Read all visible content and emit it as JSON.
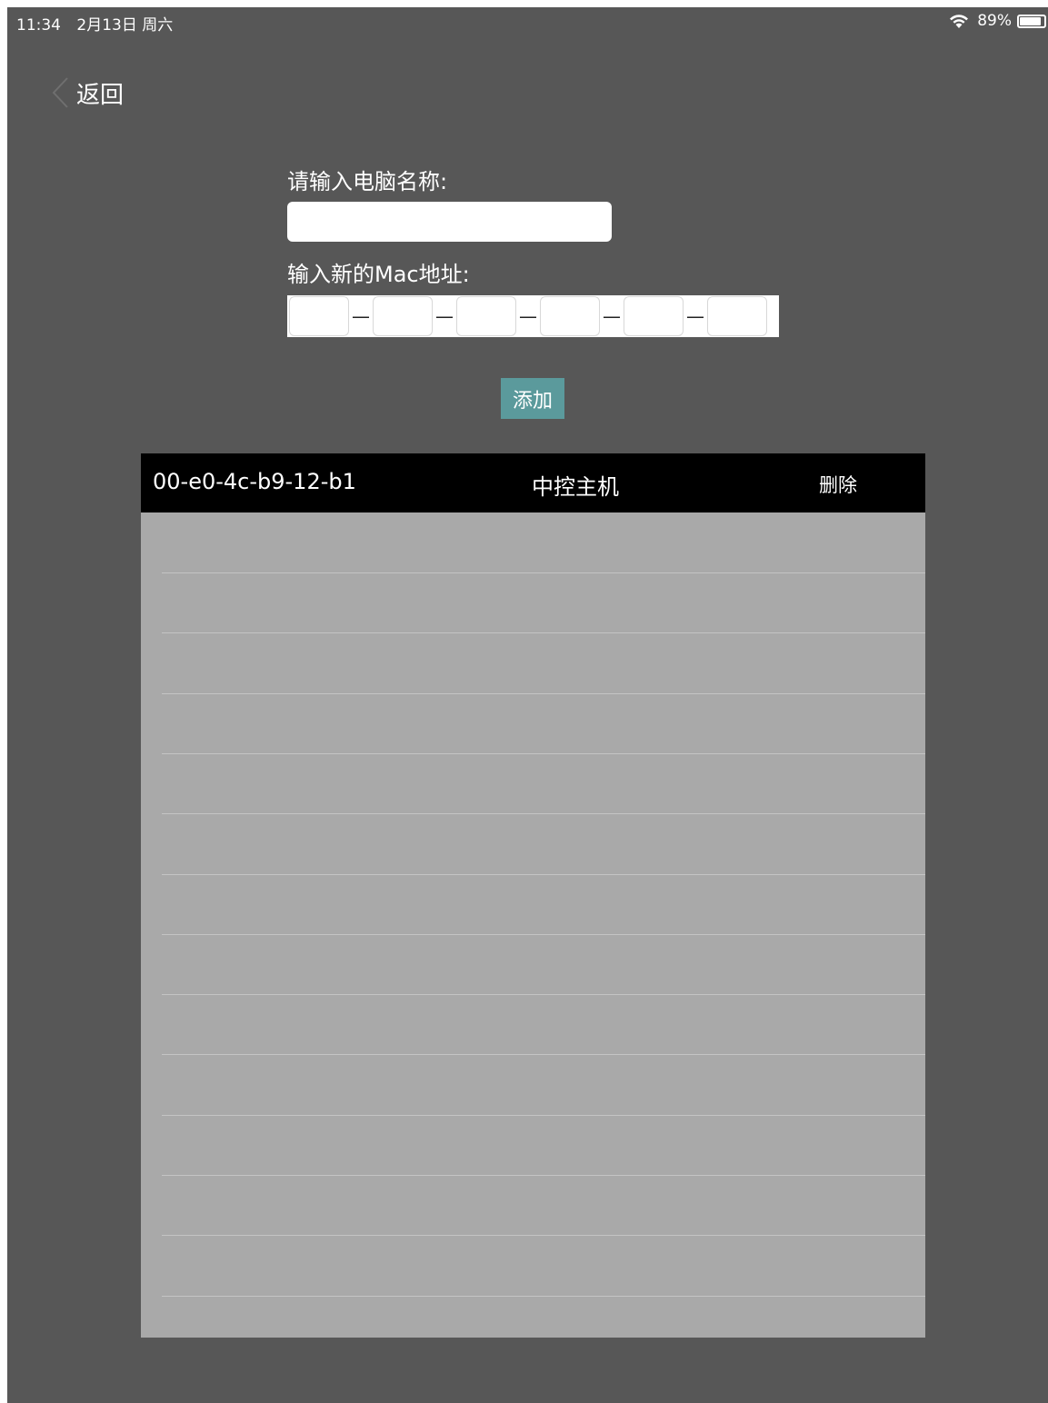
{
  "status_bar": {
    "time": "11:34",
    "date": "2月13日 周六",
    "battery": "89%",
    "battery_level": 0.89,
    "icons": [
      "wifi-icon",
      "battery-icon"
    ]
  },
  "nav": {
    "back_label": "返回",
    "back_icon": "chevron-left-icon"
  },
  "form": {
    "name_label": "请输入电脑名称:",
    "name_value": "",
    "mac_label": "输入新的Mac地址:",
    "mac_segments": [
      "",
      "",
      "",
      "",
      "",
      ""
    ],
    "mac_separator": "—",
    "add_label": "添加"
  },
  "devices": [
    {
      "mac": "00-e0-4c-b9-12-b1",
      "name": "中控主机",
      "delete_label": "删除"
    }
  ],
  "colors": {
    "background": "#575757",
    "add_button": "#5b9a9c",
    "table_body": "#a9a9a9",
    "row_header": "#000000"
  }
}
